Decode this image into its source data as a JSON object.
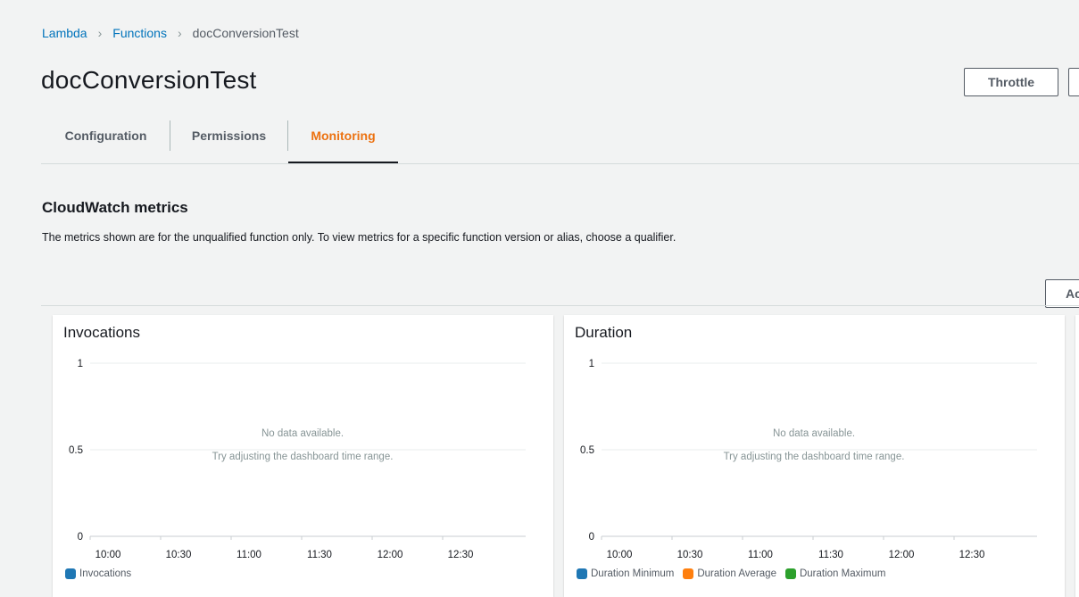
{
  "breadcrumb": {
    "items": [
      "Lambda",
      "Functions"
    ],
    "current": "docConversionTest",
    "separator": ">"
  },
  "header": {
    "title": "docConversionTest",
    "throttle_label": "Throttle"
  },
  "tabs": [
    {
      "label": "Configuration",
      "active": false
    },
    {
      "label": "Permissions",
      "active": false
    },
    {
      "label": "Monitoring",
      "active": true
    }
  ],
  "section": {
    "title": "CloudWatch metrics",
    "description": "The metrics shown are for the unqualified function only. To view metrics for a specific function version or alias, choose a qualifier.",
    "add_button_label": "Ac"
  },
  "colors": {
    "link": "#0073bb",
    "active_tab": "#ec7211",
    "series_blue": "#1f77b4",
    "series_orange": "#ff7f0e",
    "series_green": "#2ca02c"
  },
  "chart_data": [
    {
      "type": "line",
      "title": "Invocations",
      "x_ticks": [
        "10:00",
        "10:30",
        "11:00",
        "11:30",
        "12:00",
        "12:30"
      ],
      "y_ticks": [
        "0",
        "0.5",
        "1"
      ],
      "ylim": [
        0,
        1
      ],
      "series": [
        {
          "name": "Invocations",
          "values": [],
          "color": "#1f77b4"
        }
      ],
      "no_data_message": "No data available.",
      "no_data_hint": "Try adjusting the dashboard time range.",
      "grid": true,
      "legend_position": "bottom-left"
    },
    {
      "type": "line",
      "title": "Duration",
      "x_ticks": [
        "10:00",
        "10:30",
        "11:00",
        "11:30",
        "12:00",
        "12:30"
      ],
      "y_ticks": [
        "0",
        "0.5",
        "1"
      ],
      "ylim": [
        0,
        1
      ],
      "series": [
        {
          "name": "Duration Minimum",
          "values": [],
          "color": "#1f77b4"
        },
        {
          "name": "Duration Average",
          "values": [],
          "color": "#ff7f0e"
        },
        {
          "name": "Duration Maximum",
          "values": [],
          "color": "#2ca02c"
        }
      ],
      "no_data_message": "No data available.",
      "no_data_hint": "Try adjusting the dashboard time range.",
      "grid": true,
      "legend_position": "bottom-left"
    }
  ]
}
